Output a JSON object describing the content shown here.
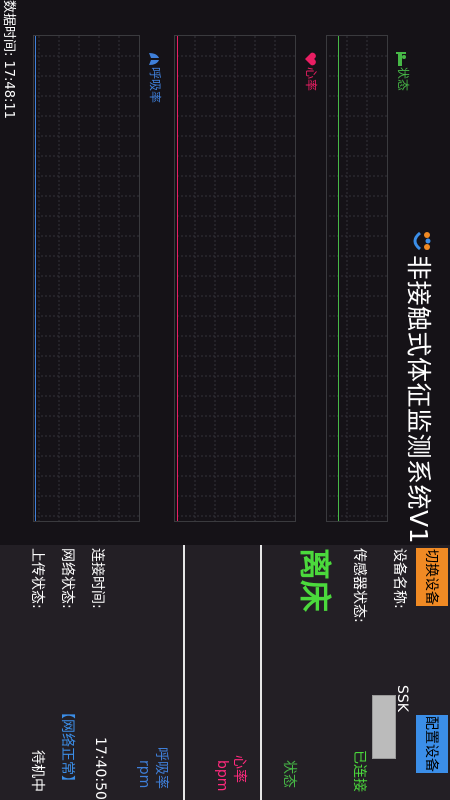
{
  "app": {
    "title": "非接触式体征监测系统V1"
  },
  "charts": {
    "status": {
      "label": "状态",
      "color": "#47b847",
      "icon": "bed-icon"
    },
    "heart": {
      "label": "心率",
      "color": "#e91e63",
      "icon": "heart-icon"
    },
    "resp": {
      "label": "呼吸率",
      "color": "#3f7fd9",
      "icon": "lungs-icon"
    }
  },
  "side": {
    "switch_btn": "切换设备",
    "config_btn": "配置设备",
    "device_name_label": "设备名称:",
    "device_name_value": "SSK_",
    "sensor_label": "传感器状态:",
    "sensor_value": "已连接",
    "bed_status": "离床",
    "bed_status_caption": "状态",
    "heart_caption": "心率",
    "heart_unit": "bpm",
    "resp_caption": "呼吸率",
    "resp_unit": "rpm",
    "conn_time_label": "连接时间:",
    "conn_time_value": "17:40:50",
    "net_label": "网络状态:",
    "net_value": "【网络正常】",
    "upload_label": "上传状态:",
    "upload_value": "待机中"
  },
  "footer": {
    "data_time": "数据时间:  17:48:11"
  },
  "colors": {
    "orange": "#f08a24",
    "blue": "#3b8ee8",
    "green": "#4bd93c",
    "pink": "#ff2a7d",
    "resp": "#3f7fd9"
  }
}
